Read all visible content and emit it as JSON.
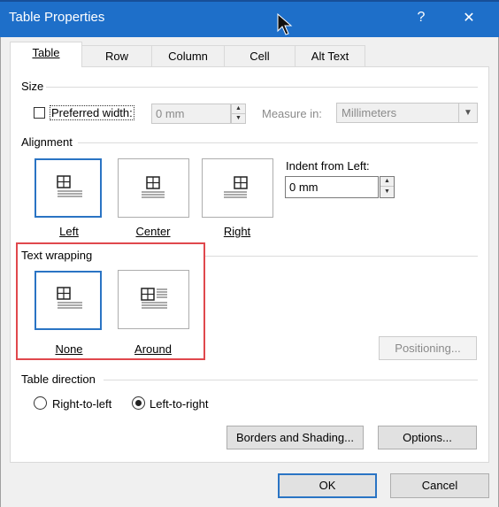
{
  "dialog": {
    "title": "Table Properties",
    "help": "?",
    "close": "✕"
  },
  "tabs": [
    {
      "label": "Table",
      "active": true
    },
    {
      "label": "Row"
    },
    {
      "label": "Column"
    },
    {
      "label": "Cell"
    },
    {
      "label": "Alt Text"
    }
  ],
  "size": {
    "section": "Size",
    "preferred_width_label": "Preferred width:",
    "preferred_width_value": "0 mm",
    "measure_in_label": "Measure in:",
    "measure_in_value": "Millimeters"
  },
  "alignment": {
    "section": "Alignment",
    "options": [
      "Left",
      "Center",
      "Right"
    ],
    "selected": "Left",
    "indent_label": "Indent from Left:",
    "indent_value": "0 mm"
  },
  "text_wrapping": {
    "section": "Text wrapping",
    "options": [
      "None",
      "Around"
    ],
    "selected": "None",
    "positioning_button": "Positioning..."
  },
  "table_direction": {
    "section": "Table direction",
    "options": [
      "Right-to-left",
      "Left-to-right"
    ],
    "selected": "Left-to-right"
  },
  "buttons": {
    "borders_shading": "Borders and Shading...",
    "options": "Options...",
    "ok": "OK",
    "cancel": "Cancel"
  },
  "colors": {
    "titlebar": "#1e6fc9",
    "selection": "#2a74c4",
    "highlight": "#e0484d"
  }
}
